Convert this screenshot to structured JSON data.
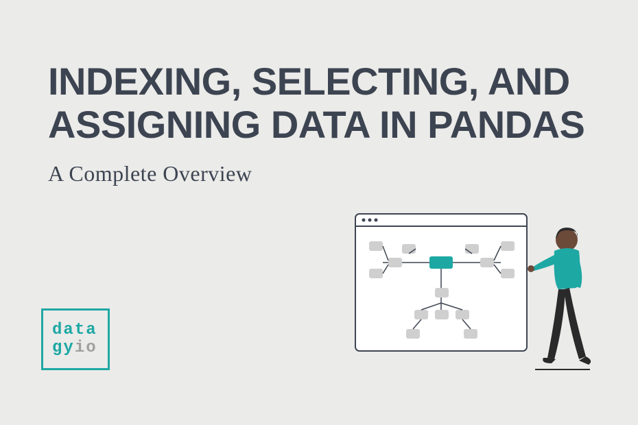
{
  "title": "INDEXING, SELECTING, AND ASSIGNING DATA IN PANDAS",
  "subtitle": "A Complete Overview",
  "logo": {
    "line1": "data",
    "line2_a": "gy",
    "line2_b": "io"
  },
  "colors": {
    "background": "#ebebe9",
    "text": "#3d4451",
    "accent": "#1ea8a4",
    "muted": "#a0a0a0"
  }
}
